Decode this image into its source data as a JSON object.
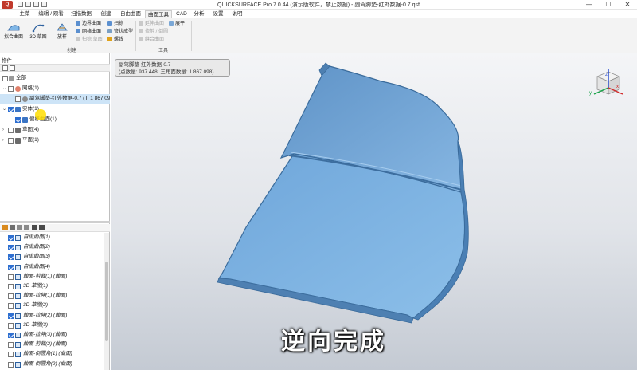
{
  "window": {
    "title": "QUICKSURFACE Pro 7.0.44 (演示版软件，禁止数据) - 副驾脚垫-红外数据-0.7.qsf",
    "logo": "Q",
    "controls": [
      "—",
      "☐",
      "✕"
    ]
  },
  "menu": {
    "tabs": [
      "主菜",
      "编辑 / 观看",
      "扫描数据",
      "创建",
      "自由曲面",
      "曲面工具",
      "CAD",
      "分析",
      "设置",
      "说明"
    ],
    "active": "曲面工具"
  },
  "ribbon": {
    "big_buttons": [
      {
        "label": "拟合曲面",
        "icon": "fit-surface-icon"
      },
      {
        "label": "3D 草图",
        "icon": "sketch-3d-icon"
      },
      {
        "label": "放样",
        "icon": "loft-icon"
      }
    ],
    "create_items": [
      "边界曲面",
      "网格曲面",
      "扫掠 草图",
      "扫掠",
      "管状成型",
      "螺线"
    ],
    "tools_items": [
      "延伸曲面",
      "修剪 / 倒圆",
      "缝合曲面",
      "展平"
    ],
    "groups": [
      "创建",
      "工具"
    ]
  },
  "panel": {
    "title": "物件",
    "tree": [
      {
        "label": "全部",
        "level": 0,
        "expand": "",
        "checked": false
      },
      {
        "label": "网格(1)",
        "level": 1,
        "expand": "⌄",
        "checked": false
      },
      {
        "label": "副驾脚垫-红外数据-0.7 (T: 1 867 098)",
        "level": 2,
        "expand": "",
        "checked": false
      },
      {
        "label": "实体(1)",
        "level": 1,
        "expand": "⌄",
        "checked": true
      },
      {
        "label": "偏移曲面(1)",
        "level": 2,
        "expand": "",
        "checked": true
      },
      {
        "label": "草图(4)",
        "level": 1,
        "expand": "›",
        "checked": false
      },
      {
        "label": "平面(1)",
        "level": 1,
        "expand": "›",
        "checked": false
      }
    ],
    "history": [
      {
        "label": "自由曲面(1)",
        "checked": true
      },
      {
        "label": "自由曲面(2)",
        "checked": true
      },
      {
        "label": "自由曲面(3)",
        "checked": true
      },
      {
        "label": "自由曲面(4)",
        "checked": true
      },
      {
        "label": "曲面-剪裁(1) (曲面)",
        "checked": false
      },
      {
        "label": "3D 草图(1)",
        "checked": false
      },
      {
        "label": "曲面-拉伸(1) (曲面)",
        "checked": false
      },
      {
        "label": "3D 草图(2)",
        "checked": false
      },
      {
        "label": "曲面-拉伸(2) (曲面)",
        "checked": true
      },
      {
        "label": "3D 草图(3)",
        "checked": false
      },
      {
        "label": "曲面-拉伸(3) (曲面)",
        "checked": true
      },
      {
        "label": "曲面-剪裁(2) (曲面)",
        "checked": false
      },
      {
        "label": "曲面-倒圆角(1) (曲面)",
        "checked": false
      },
      {
        "label": "曲面-倒圆角(2) (曲面)",
        "checked": false
      }
    ]
  },
  "viewport": {
    "info_line1": "副驾脚垫-红外数据-0.7",
    "info_line2": "(点数量: 937 448, 三角面数量: 1 867 098)",
    "subtitle": "逆向完成",
    "axes": {
      "x": "x",
      "y": "y",
      "z": "z"
    }
  },
  "colors": {
    "model_face": "#7eb1e0",
    "model_dark": "#3f6f9d",
    "accent": "#2e6fd1"
  }
}
